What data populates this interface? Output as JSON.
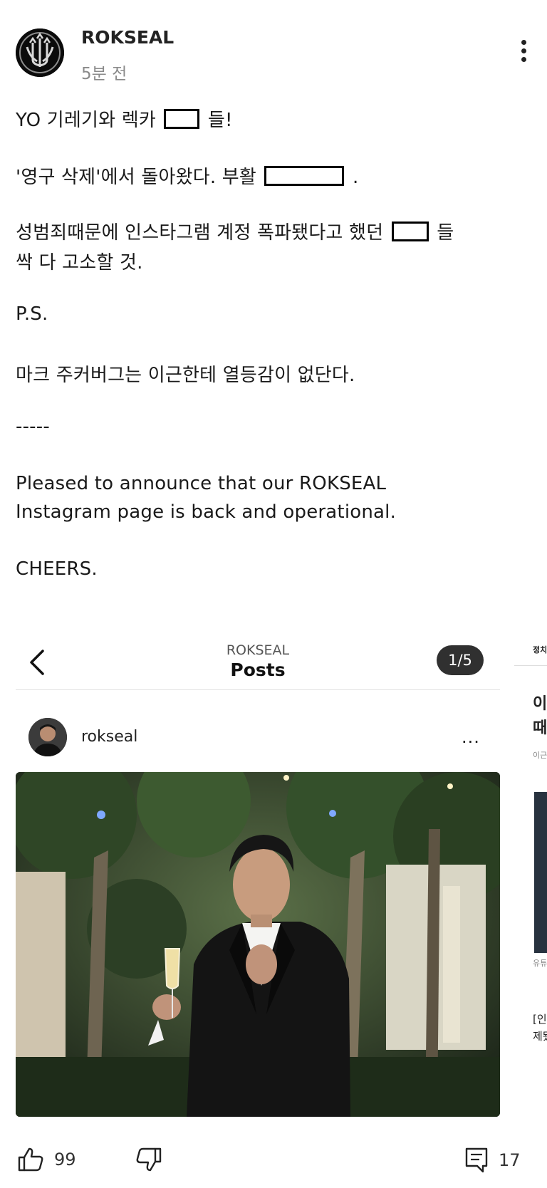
{
  "post": {
    "author": "ROKSEAL",
    "time": "5분 전",
    "lines": {
      "l1a": "YO 기레기와 렉카",
      "l1b": "들!",
      "l2a": "'영구 삭제'에서 돌아왔다. 부활",
      "l2b": ".",
      "l3a": "성범죄때문에 인스타그램 계정 폭파됐다고 했던",
      "l3b": "들",
      "l4": "싹 다 고소할 것.",
      "l5": "P.S.",
      "l6": "마크 주커버그는 이근한테 열등감이 없단다.",
      "l7": "-----",
      "l8": "Pleased to announce that our ROKSEAL",
      "l9": "Instagram page is back and operational.",
      "l10": "CHEERS."
    }
  },
  "embed": {
    "account": "ROKSEAL",
    "title": "Posts",
    "counter": "1/5",
    "username": "rokseal",
    "more": "..."
  },
  "side_fragment": {
    "tab": "정치",
    "h1": "이",
    "h2": "때",
    "s1": "이근",
    "s2": "유튜",
    "s3": "[인",
    "s4": "제됐"
  },
  "actions": {
    "likes": "99",
    "comments": "17"
  },
  "icons": {
    "more": "more-vertical-icon",
    "back": "chevron-left-icon",
    "like": "thumbs-up-icon",
    "dislike": "thumbs-down-icon",
    "comment": "comment-icon"
  }
}
